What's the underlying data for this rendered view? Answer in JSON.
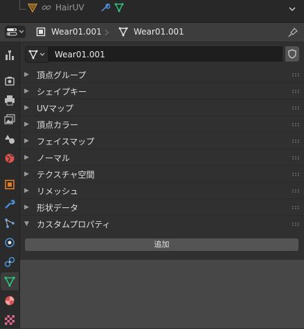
{
  "outliner": {
    "item_label": "HairUV"
  },
  "header": {
    "object_name": "Wear01.001",
    "mesh_name": "Wear01.001"
  },
  "mesh_field": {
    "value": "Wear01.001"
  },
  "panels": [
    {
      "label": "頂点グループ",
      "expanded": false
    },
    {
      "label": "シェイプキー",
      "expanded": false
    },
    {
      "label": "UVマップ",
      "expanded": false
    },
    {
      "label": "頂点カラー",
      "expanded": false
    },
    {
      "label": "フェイスマップ",
      "expanded": false
    },
    {
      "label": "ノーマル",
      "expanded": false
    },
    {
      "label": "テクスチャ空間",
      "expanded": false
    },
    {
      "label": "リメッシュ",
      "expanded": false
    },
    {
      "label": "形状データ",
      "expanded": false
    },
    {
      "label": "カスタムプロパティ",
      "expanded": true
    }
  ],
  "custom_properties": {
    "add_label": "追加"
  },
  "tabs": [
    {
      "name": "tool-tab",
      "icon": "tool-icon"
    },
    {
      "name": "render-tab",
      "icon": "render-icon"
    },
    {
      "name": "output-tab",
      "icon": "printer-icon"
    },
    {
      "name": "view-layer-tab",
      "icon": "image-stack-icon"
    },
    {
      "name": "scene-tab",
      "icon": "scene-icon"
    },
    {
      "name": "world-tab",
      "icon": "world-icon"
    },
    {
      "name": "object-tab",
      "icon": "object-icon"
    },
    {
      "name": "modifier-tab",
      "icon": "wrench-icon"
    },
    {
      "name": "particles-tab",
      "icon": "particles-icon"
    },
    {
      "name": "physics-tab",
      "icon": "physics-icon"
    },
    {
      "name": "constraints-tab",
      "icon": "constraints-icon"
    },
    {
      "name": "data-tab",
      "icon": "mesh-data-icon",
      "active": true
    },
    {
      "name": "material-tab",
      "icon": "material-icon"
    },
    {
      "name": "texture-tab",
      "icon": "texture-icon"
    }
  ],
  "colors": {
    "accent_green": "#2ec27e",
    "object_orange": "#e07b2a",
    "modifier_blue": "#4a8fd8",
    "material_red": "#d9534f"
  }
}
